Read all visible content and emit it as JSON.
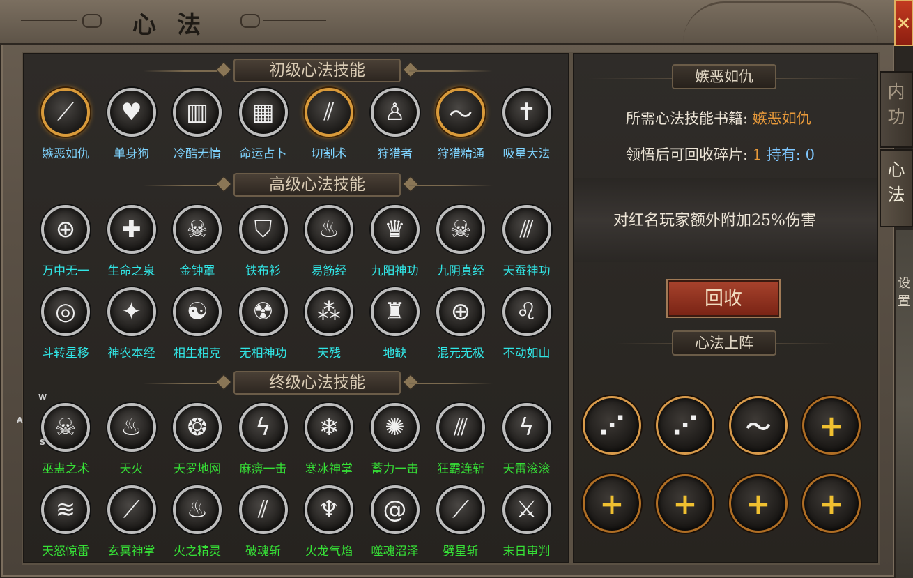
{
  "window": {
    "title": "心法",
    "close_label": "×"
  },
  "side_tabs": [
    {
      "label": "内功",
      "active": false
    },
    {
      "label": "心法",
      "active": true
    }
  ],
  "map_fragment": {
    "text": "设置",
    "compass": [
      "W",
      "A",
      "S"
    ]
  },
  "sections": [
    {
      "title": "初级心法技能",
      "label_color": "#7fd4ff",
      "skills": [
        {
          "name": "嫉恶如仇",
          "icon": "claw-slash-icon",
          "highlight": true
        },
        {
          "name": "单身狗",
          "icon": "heart-dog-icon",
          "highlight": false
        },
        {
          "name": "冷酷无情",
          "icon": "cage-icon",
          "highlight": false
        },
        {
          "name": "命运占卜",
          "icon": "checkered-cards-icon",
          "highlight": false
        },
        {
          "name": "切割术",
          "icon": "triple-blade-icon",
          "highlight": true
        },
        {
          "name": "狩猎者",
          "icon": "hunter-figure-icon",
          "highlight": false
        },
        {
          "name": "狩猎精通",
          "icon": "wave-spear-icon",
          "highlight": true
        },
        {
          "name": "吸星大法",
          "icon": "cross-figure-icon",
          "highlight": false
        }
      ]
    },
    {
      "title": "高级心法技能",
      "label_color": "#31e6e6",
      "skills": [
        {
          "name": "万中无一",
          "icon": "crosshair-tower-icon"
        },
        {
          "name": "生命之泉",
          "icon": "healer-icon"
        },
        {
          "name": "金钟罩",
          "icon": "skull-shield-icon"
        },
        {
          "name": "铁布衫",
          "icon": "body-shield-icon"
        },
        {
          "name": "易筋经",
          "icon": "flame-orbs-icon"
        },
        {
          "name": "九阳神功",
          "icon": "fire-crown-icon"
        },
        {
          "name": "九阴真经",
          "icon": "dripping-skull-icon"
        },
        {
          "name": "天蚕神功",
          "icon": "silk-claws-icon"
        },
        {
          "name": "斗转星移",
          "icon": "rings-icon"
        },
        {
          "name": "神农本经",
          "icon": "star-skull-icon"
        },
        {
          "name": "相生相克",
          "icon": "yin-yang-icon"
        },
        {
          "name": "无相神功",
          "icon": "demon-face-icon"
        },
        {
          "name": "天残",
          "icon": "orbs-icon"
        },
        {
          "name": "地缺",
          "icon": "spiked-crown-icon"
        },
        {
          "name": "混元无极",
          "icon": "crosshair-temple-icon"
        },
        {
          "name": "不动如山",
          "icon": "lion-head-icon"
        }
      ]
    },
    {
      "title": "终级心法技能",
      "label_color": "#36e036",
      "skills": [
        {
          "name": "巫蛊之术",
          "icon": "skull-flowers-icon"
        },
        {
          "name": "天火",
          "icon": "sky-fire-icon"
        },
        {
          "name": "天罗地网",
          "icon": "net-figure-icon"
        },
        {
          "name": "麻痹一击",
          "icon": "lightning-strike-icon"
        },
        {
          "name": "寒冰神掌",
          "icon": "ice-palm-icon"
        },
        {
          "name": "蓄力一击",
          "icon": "charge-blast-icon"
        },
        {
          "name": "狂霸连斩",
          "icon": "combo-slash-icon"
        },
        {
          "name": "天雷滚滚",
          "icon": "thunder-bolt-icon"
        },
        {
          "name": "天怒惊雷",
          "icon": "storm-wave-icon"
        },
        {
          "name": "玄冥神掌",
          "icon": "dark-palm-icon"
        },
        {
          "name": "火之精灵",
          "icon": "fire-spirit-icon"
        },
        {
          "name": "破魂斩",
          "icon": "soul-slash-icon"
        },
        {
          "name": "火龙气焰",
          "icon": "fire-dragon-icon"
        },
        {
          "name": "噬魂沼泽",
          "icon": "swamp-vortex-icon"
        },
        {
          "name": "劈星斩",
          "icon": "star-cleave-icon"
        },
        {
          "name": "末日审判",
          "icon": "judgment-sword-icon"
        }
      ]
    }
  ],
  "detail": {
    "plate_title": "嫉恶如仇",
    "book_label": "所需心法技能书籍:",
    "book_value": "嫉恶如仇",
    "fragment_label": "领悟后可回收碎片:",
    "fragment_value": "1",
    "owned_label": "持有:",
    "owned_value": "0",
    "description": "对红名玩家额外附加25%伤害",
    "recycle_button": "回收"
  },
  "loadout": {
    "title": "心法上阵",
    "slots": [
      {
        "filled": true,
        "icon": "claw-slash-icon",
        "symbol": "⋰"
      },
      {
        "filled": true,
        "icon": "triple-blade-icon",
        "symbol": "⋰"
      },
      {
        "filled": true,
        "icon": "wave-spear-icon",
        "symbol": "〜"
      },
      {
        "filled": false,
        "icon": "plus-icon",
        "symbol": "+"
      },
      {
        "filled": false,
        "icon": "plus-icon",
        "symbol": "+"
      },
      {
        "filled": false,
        "icon": "plus-icon",
        "symbol": "+"
      },
      {
        "filled": false,
        "icon": "plus-icon",
        "symbol": "+"
      },
      {
        "filled": false,
        "icon": "plus-icon",
        "symbol": "+"
      }
    ]
  },
  "colors": {
    "basic_label": "#7fd4ff",
    "advanced_label": "#31e6e6",
    "ultimate_label": "#36e036",
    "highlight_orange": "#e99a3a",
    "recycle_button": "#a6422c"
  }
}
